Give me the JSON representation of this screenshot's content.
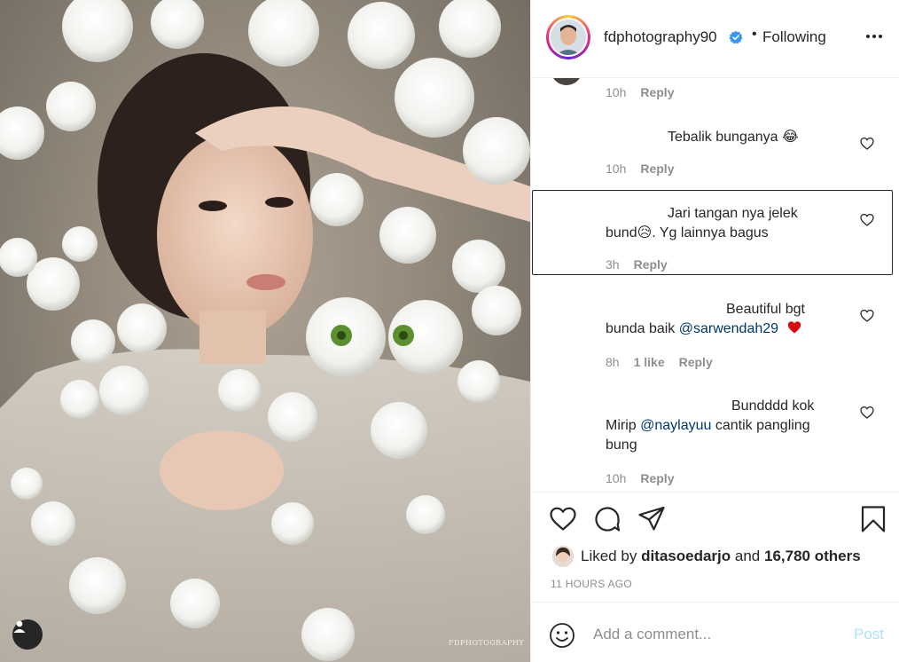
{
  "photo": {
    "watermark": "FDPHOTOGRAPHY",
    "tag_icon": "user-tag-icon"
  },
  "header": {
    "username": "fdphotography90",
    "separator": "•",
    "follow_status": "Following",
    "verified_icon": "verified-badge-icon",
    "more_icon": "more-options-icon"
  },
  "comments": [
    {
      "text": "",
      "time": "10h",
      "reply": "Reply"
    },
    {
      "text": "Tebalik bunganya 😂",
      "time": "10h",
      "reply": "Reply"
    },
    {
      "text_line1": "Jari tangan nya jelek",
      "text_line2": "bund😥. Yg lainnya bagus",
      "time": "3h",
      "reply": "Reply"
    },
    {
      "text_line1": "Beautiful bgt",
      "text_line2_prefix": "bunda baik ",
      "mention": "@sarwendah29",
      "emoji": "❤️",
      "time": "8h",
      "likes": "1 like",
      "reply": "Reply"
    },
    {
      "text_line1": "Bundddd kok",
      "text_line2_prefix": "Mirip ",
      "mention": "@naylayuu",
      "text_line2_suffix": " cantik pangling",
      "text_line3": "bung",
      "time": "10h",
      "reply": "Reply"
    }
  ],
  "actions": {
    "like_icon": "heart-icon",
    "comment_icon": "comment-icon",
    "share_icon": "send-icon",
    "save_icon": "bookmark-icon"
  },
  "likes": {
    "prefix": "Liked by ",
    "user": "ditasoedarjo",
    "middle": " and ",
    "count": "16,780 others"
  },
  "timestamp": "11 HOURS AGO",
  "add_comment": {
    "placeholder": "Add a comment...",
    "post_label": "Post",
    "emoji_icon": "emoji-icon"
  },
  "colors": {
    "link": "#00376b",
    "muted": "#8e8e8e",
    "verified": "#3897f0",
    "post_disabled": "#b2dffc",
    "heart_red": "#ed4956"
  }
}
